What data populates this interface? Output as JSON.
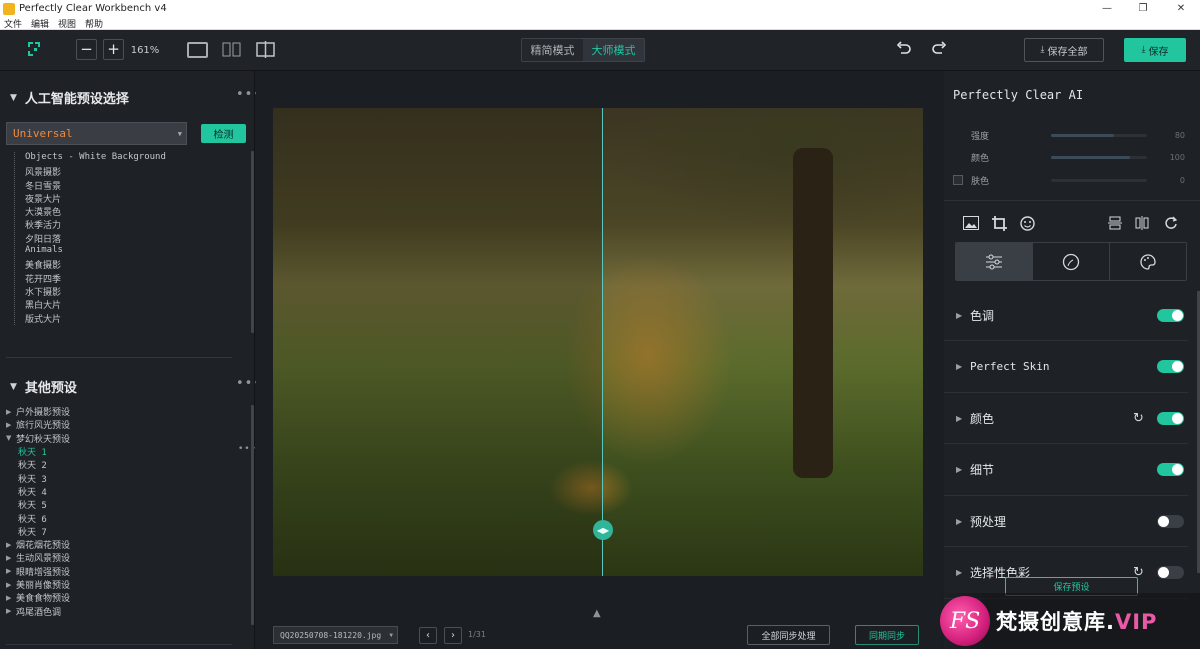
{
  "window": {
    "title": "Perfectly Clear Workbench v4",
    "controls": [
      "—",
      "❐",
      "✕"
    ]
  },
  "menu": [
    "文件",
    "编辑",
    "视图",
    "帮助"
  ],
  "toolbar": {
    "zoom": "161%",
    "zoom_out": "−",
    "zoom_in": "+",
    "mode_simple": "精简模式",
    "mode_master": "大师模式",
    "save_all": "保存全部",
    "save": "保存"
  },
  "left": {
    "ai_section_title": "人工智能预设选择",
    "preset_value": "Universal",
    "detect_label": "检测",
    "ai_presets": [
      "Objects - White Background",
      "风景摄影",
      "冬日雪景",
      "夜景大片",
      "大漠景色",
      "秋季活力",
      "夕阳日落",
      "Animals",
      "美食摄影",
      "花开四季",
      "水下摄影",
      "黑白大片",
      "版式大片"
    ],
    "other_section_title": "其他预设",
    "other_presets": [
      {
        "label": "户外摄影预设",
        "kind": "group"
      },
      {
        "label": "旅行风光预设",
        "kind": "group"
      },
      {
        "label": "梦幻秋天预设",
        "kind": "open"
      },
      {
        "label": "秋天 1",
        "kind": "child-active"
      },
      {
        "label": "秋天 2",
        "kind": "child"
      },
      {
        "label": "秋天 3",
        "kind": "child"
      },
      {
        "label": "秋天 4",
        "kind": "child"
      },
      {
        "label": "秋天 5",
        "kind": "child"
      },
      {
        "label": "秋天 6",
        "kind": "child"
      },
      {
        "label": "秋天 7",
        "kind": "child"
      },
      {
        "label": "烟花烟花预设",
        "kind": "group"
      },
      {
        "label": "生动风景预设",
        "kind": "group"
      },
      {
        "label": "眼睛增强预设",
        "kind": "group"
      },
      {
        "label": "美丽肖像预设",
        "kind": "group"
      },
      {
        "label": "美食食物预设",
        "kind": "group"
      },
      {
        "label": "鸡尾酒色调",
        "kind": "group"
      }
    ]
  },
  "canvas": {
    "filename": "QQ20250708-181220.jpg",
    "counter": "1/31",
    "sync_all": "全部同步处理",
    "sync": "同期同步"
  },
  "right": {
    "ai_title": "Perfectly Clear AI",
    "sliders": [
      {
        "label": "强度",
        "value": "80",
        "fraction": 0.8,
        "checkbox": false
      },
      {
        "label": "颜色",
        "value": "100",
        "fraction": 1.0,
        "checkbox": false
      },
      {
        "label": "肤色",
        "value": "0",
        "fraction": 0.0,
        "checkbox": true
      }
    ],
    "adjustments": [
      {
        "name": "色调",
        "on": true,
        "reset": false
      },
      {
        "name": "Perfect Skin",
        "on": true,
        "reset": false
      },
      {
        "name": "颜色",
        "on": true,
        "reset": true
      },
      {
        "name": "细节",
        "on": true,
        "reset": false
      },
      {
        "name": "预处理",
        "on": false,
        "reset": false
      },
      {
        "name": "选择性色彩",
        "on": false,
        "reset": true
      }
    ],
    "save_preset": "保存预设"
  },
  "watermark": {
    "logo": "FS",
    "text": "梵摄创意库.",
    "vip": "VIP"
  },
  "colors": {
    "accent": "#21c69f",
    "bg": "#1b1e22",
    "panel": "#1e2125"
  }
}
